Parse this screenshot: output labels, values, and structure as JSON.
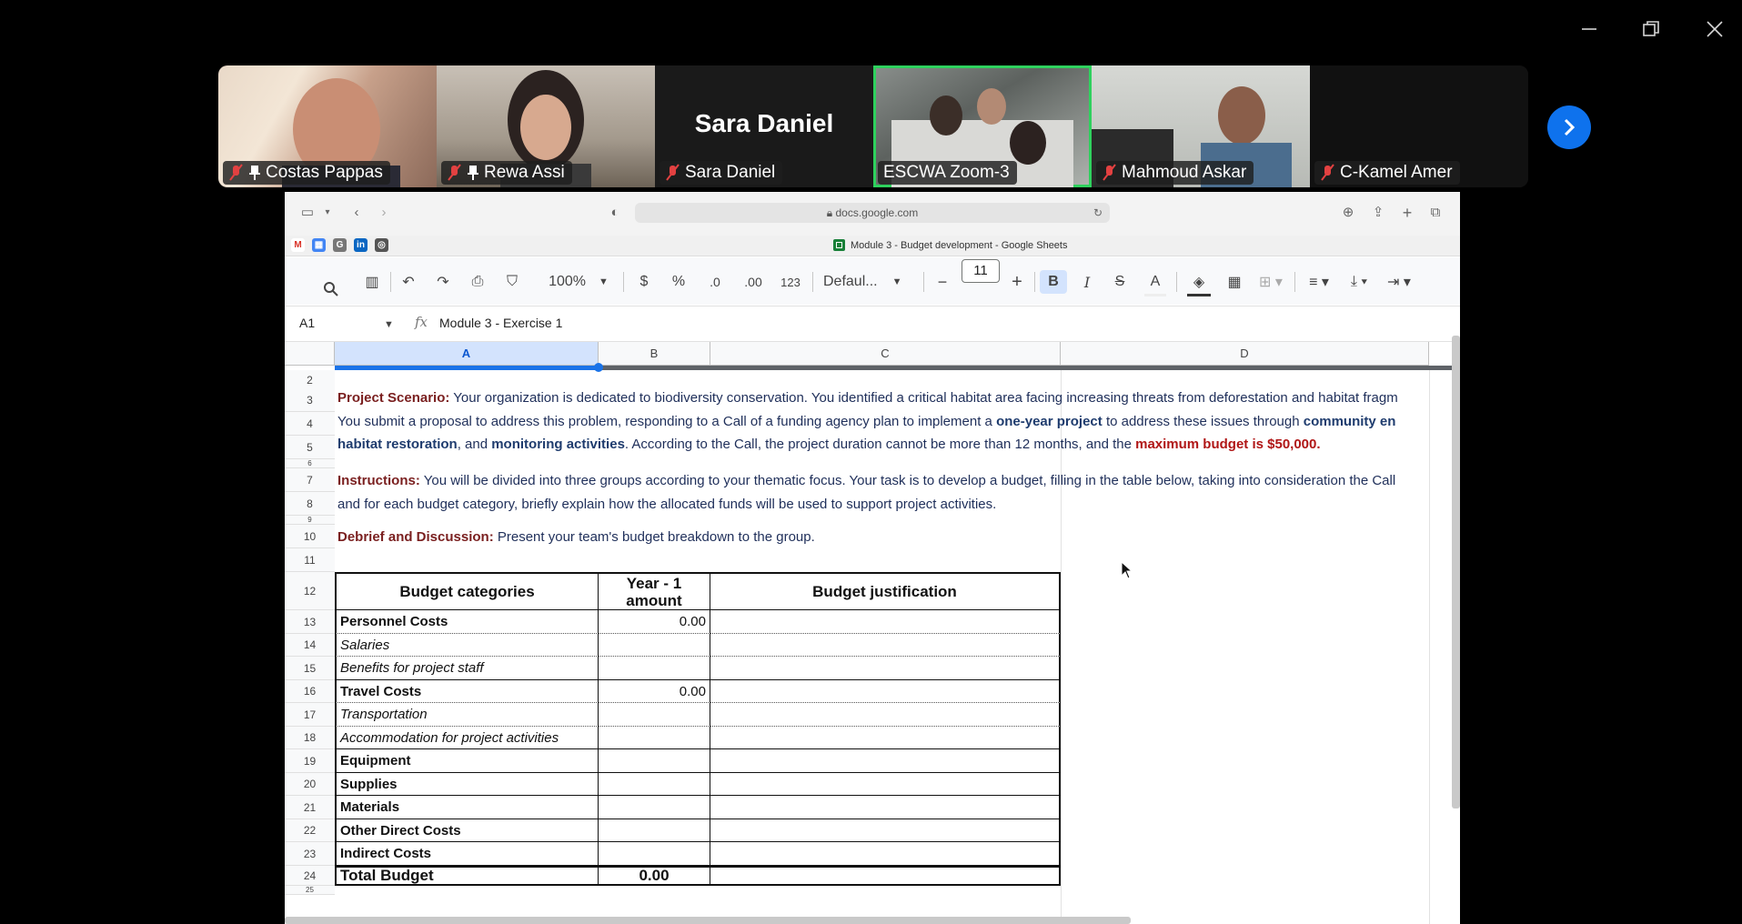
{
  "window_controls": {
    "minimize": "minimize-icon",
    "restore": "restore-icon",
    "close": "close-icon"
  },
  "participants": [
    {
      "name": "Costas Pappas",
      "muted": true,
      "pinned": true
    },
    {
      "name": "Rewa Assi",
      "muted": true,
      "pinned": true
    },
    {
      "name": "Sara Daniel",
      "muted": true,
      "pinned": false,
      "display_name": "Sara Daniel"
    },
    {
      "name": "ESCWA Zoom-3",
      "muted": false,
      "pinned": false,
      "active": true
    },
    {
      "name": "Mahmoud Askar",
      "muted": true,
      "pinned": false
    },
    {
      "name": "C-Kamel Amer",
      "muted": true,
      "pinned": false
    }
  ],
  "browser": {
    "url": "docs.google.com",
    "tab_title": "Module 3 - Budget development - Google Sheets"
  },
  "toolbar": {
    "zoom": "100%",
    "currency": "$",
    "percent": "%",
    "dec_decrease": ".0",
    "dec_increase": ".00",
    "number_format": "123",
    "font": "Defaul...",
    "font_size": "11",
    "minus": "−",
    "plus": "+"
  },
  "formula_bar": {
    "cell_ref": "A1",
    "fx": "fx",
    "value": "Module 3 - Exercise 1"
  },
  "columns": [
    "A",
    "B",
    "C",
    "D"
  ],
  "rows": [
    "2",
    "3",
    "4",
    "5",
    "6",
    "7",
    "8",
    "9",
    "10",
    "11",
    "12",
    "13",
    "14",
    "15",
    "16",
    "17",
    "18",
    "19",
    "20",
    "21",
    "22",
    "23",
    "24",
    "25"
  ],
  "text": {
    "r3_label": "Project Scenario:",
    "r3_text": " Your organization is dedicated to biodiversity conservation. You identified a critical habitat area facing increasing threats from deforestation and habitat fragm",
    "r4_a": "You submit a proposal to address this problem, responding to a Call of a funding agency plan to implement a ",
    "r4_b": "one-year project",
    "r4_c": " to address these issues through ",
    "r4_d": "community en",
    "r5_a": "habitat restoration",
    "r5_b": ", and ",
    "r5_c": "monitoring activities",
    "r5_d": ". According to the Call, the project duration cannot be more than 12 months, and the ",
    "r5_e": "maximum budget is $50,000.",
    "r7_label": "Instructions:",
    "r7_text": " You will be divided into three groups according to your thematic focus. Your task is to develop a budget, filling in the table below, taking into consideration the Call",
    "r8_text": "and for each budget category, briefly explain how the allocated funds will be used to support project activities.",
    "r10_label": "Debrief and Discussion:",
    "r10_text": " Present your team's budget breakdown to the group."
  },
  "table": {
    "headers": {
      "category": "Budget categories",
      "amount": "Year - 1\namount",
      "justification": "Budget justification"
    },
    "rows": [
      {
        "row": "13",
        "category": "Personnel Costs",
        "amount": "0.00",
        "style": "bold"
      },
      {
        "row": "14",
        "category": "Salaries",
        "amount": "",
        "style": "italic"
      },
      {
        "row": "15",
        "category": "Benefits for project staff",
        "amount": "",
        "style": "italic"
      },
      {
        "row": "16",
        "category": "Travel Costs",
        "amount": "0.00",
        "style": "bold"
      },
      {
        "row": "17",
        "category": "Transportation",
        "amount": "",
        "style": "italic"
      },
      {
        "row": "18",
        "category": "Accommodation for project activities",
        "amount": "",
        "style": "italic"
      },
      {
        "row": "19",
        "category": "Equipment",
        "amount": "",
        "style": "bold"
      },
      {
        "row": "20",
        "category": "Supplies",
        "amount": "",
        "style": "bold"
      },
      {
        "row": "21",
        "category": "Materials",
        "amount": "",
        "style": "bold"
      },
      {
        "row": "22",
        "category": "Other Direct Costs",
        "amount": "",
        "style": "bold"
      },
      {
        "row": "23",
        "category": "Indirect Costs",
        "amount": "",
        "style": "bold"
      }
    ],
    "total": {
      "row": "24",
      "category": "Total Budget",
      "amount": "0.00"
    }
  }
}
